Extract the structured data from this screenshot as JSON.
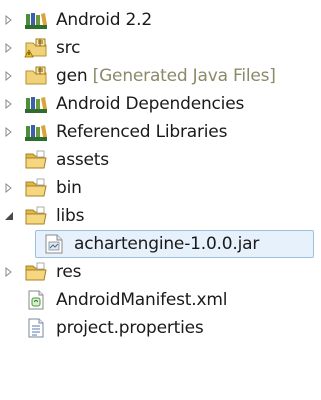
{
  "tree": {
    "items": [
      {
        "label": "Android 2.2",
        "icon": "library-icon",
        "state": "collapsed"
      },
      {
        "label": "src",
        "icon": "source-folder-warning-icon",
        "state": "collapsed"
      },
      {
        "label": "gen",
        "decoration": "[Generated Java Files]",
        "icon": "source-folder-icon",
        "state": "collapsed"
      },
      {
        "label": "Android Dependencies",
        "icon": "library-icon",
        "state": "collapsed"
      },
      {
        "label": "Referenced Libraries",
        "icon": "library-icon",
        "state": "collapsed"
      },
      {
        "label": "assets",
        "icon": "folder-icon",
        "state": "leaf"
      },
      {
        "label": "bin",
        "icon": "folder-icon",
        "state": "collapsed"
      },
      {
        "label": "libs",
        "icon": "folder-icon",
        "state": "expanded"
      },
      {
        "label": "achartengine-1.0.0.jar",
        "icon": "jar-file-icon",
        "state": "leaf",
        "selected": true
      },
      {
        "label": "res",
        "icon": "folder-icon",
        "state": "collapsed"
      },
      {
        "label": "AndroidManifest.xml",
        "icon": "xml-file-icon",
        "state": "leaf"
      },
      {
        "label": "project.properties",
        "icon": "properties-file-icon",
        "state": "leaf"
      }
    ]
  },
  "colors": {
    "selection_fill": "#e6f1fb",
    "selection_border": "#9cc0e4",
    "decoration_text": "#8a8a6a",
    "library_books": "#3a7a3a",
    "folder_yellow": "#e8c65a"
  }
}
